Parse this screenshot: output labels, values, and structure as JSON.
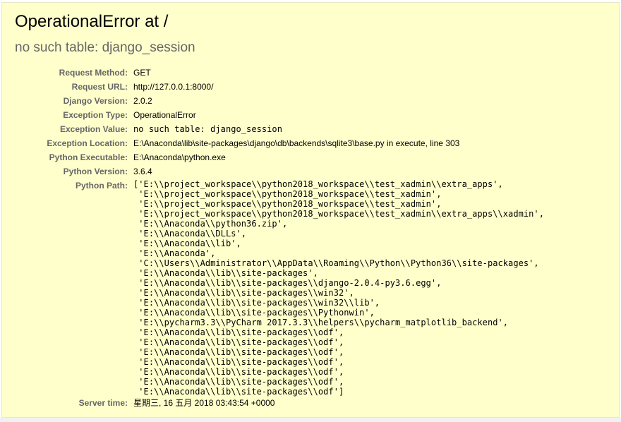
{
  "title": "OperationalError at /",
  "subtitle": "no such table: django_session",
  "meta": {
    "request_method": {
      "label": "Request Method:",
      "value": "GET"
    },
    "request_url": {
      "label": "Request URL:",
      "value": "http://127.0.0.1:8000/"
    },
    "django_version": {
      "label": "Django Version:",
      "value": "2.0.2"
    },
    "exception_type": {
      "label": "Exception Type:",
      "value": "OperationalError"
    },
    "exception_value": {
      "label": "Exception Value:",
      "value": "no such table: django_session"
    },
    "exception_location": {
      "label": "Exception Location:",
      "value": "E:\\Anaconda\\lib\\site-packages\\django\\db\\backends\\sqlite3\\base.py in execute, line 303"
    },
    "python_executable": {
      "label": "Python Executable:",
      "value": "E:\\Anaconda\\python.exe"
    },
    "python_version": {
      "label": "Python Version:",
      "value": "3.6.4"
    },
    "python_path": {
      "label": "Python Path:",
      "lines": [
        "['E:\\\\project_workspace\\\\python2018_workspace\\\\test_xadmin\\\\extra_apps',",
        " 'E:\\\\project_workspace\\\\python2018_workspace\\\\test_xadmin',",
        " 'E:\\\\project_workspace\\\\python2018_workspace\\\\test_xadmin',",
        " 'E:\\\\project_workspace\\\\python2018_workspace\\\\test_xadmin\\\\extra_apps\\\\xadmin',",
        " 'E:\\\\Anaconda\\\\python36.zip',",
        " 'E:\\\\Anaconda\\\\DLLs',",
        " 'E:\\\\Anaconda\\\\lib',",
        " 'E:\\\\Anaconda',",
        " 'C:\\\\Users\\\\Administrator\\\\AppData\\\\Roaming\\\\Python\\\\Python36\\\\site-packages',",
        " 'E:\\\\Anaconda\\\\lib\\\\site-packages',",
        " 'E:\\\\Anaconda\\\\lib\\\\site-packages\\\\django-2.0.4-py3.6.egg',",
        " 'E:\\\\Anaconda\\\\lib\\\\site-packages\\\\win32',",
        " 'E:\\\\Anaconda\\\\lib\\\\site-packages\\\\win32\\\\lib',",
        " 'E:\\\\Anaconda\\\\lib\\\\site-packages\\\\Pythonwin',",
        " 'E:\\\\pycharm3.3\\\\PyCharm 2017.3.3\\\\helpers\\\\pycharm_matplotlib_backend',",
        " 'E:\\\\Anaconda\\\\lib\\\\site-packages\\\\odf',",
        " 'E:\\\\Anaconda\\\\lib\\\\site-packages\\\\odf',",
        " 'E:\\\\Anaconda\\\\lib\\\\site-packages\\\\odf',",
        " 'E:\\\\Anaconda\\\\lib\\\\site-packages\\\\odf',",
        " 'E:\\\\Anaconda\\\\lib\\\\site-packages\\\\odf',",
        " 'E:\\\\Anaconda\\\\lib\\\\site-packages\\\\odf',",
        " 'E:\\\\Anaconda\\\\lib\\\\site-packages\\\\odf']"
      ]
    },
    "server_time": {
      "label": "Server time:",
      "value": "星期三, 16 五月 2018 03:43:54 +0000"
    }
  },
  "colors": {
    "summary_background": "#ffffcc",
    "label_color": "#666666",
    "subtitle_color": "#666666"
  }
}
